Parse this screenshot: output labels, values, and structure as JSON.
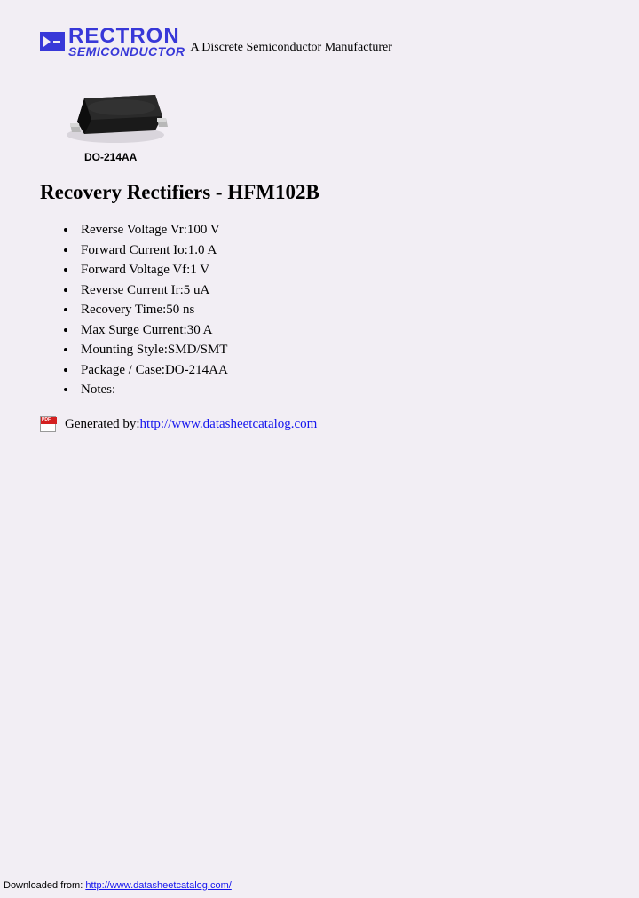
{
  "logo": {
    "main": "RECTRON",
    "sub": "SEMICONDUCTOR",
    "tagline": "A Discrete Semiconductor Manufacturer"
  },
  "package_label": "DO-214AA",
  "heading": "Recovery Rectifiers - HFM102B",
  "specs": [
    "Reverse Voltage Vr:100 V",
    "Forward Current Io:1.0 A",
    "Forward Voltage Vf:1 V",
    "Reverse Current Ir:5 uA",
    "Recovery Time:50 ns",
    "Max Surge Current:30 A",
    "Mounting Style:SMD/SMT",
    "Package / Case:DO-214AA",
    "Notes:"
  ],
  "generated_by_label": "Generated by: ",
  "generated_by_url": "http://www.datasheetcatalog.com",
  "footer_label": "Downloaded from: ",
  "footer_url": "http://www.datasheetcatalog.com/"
}
